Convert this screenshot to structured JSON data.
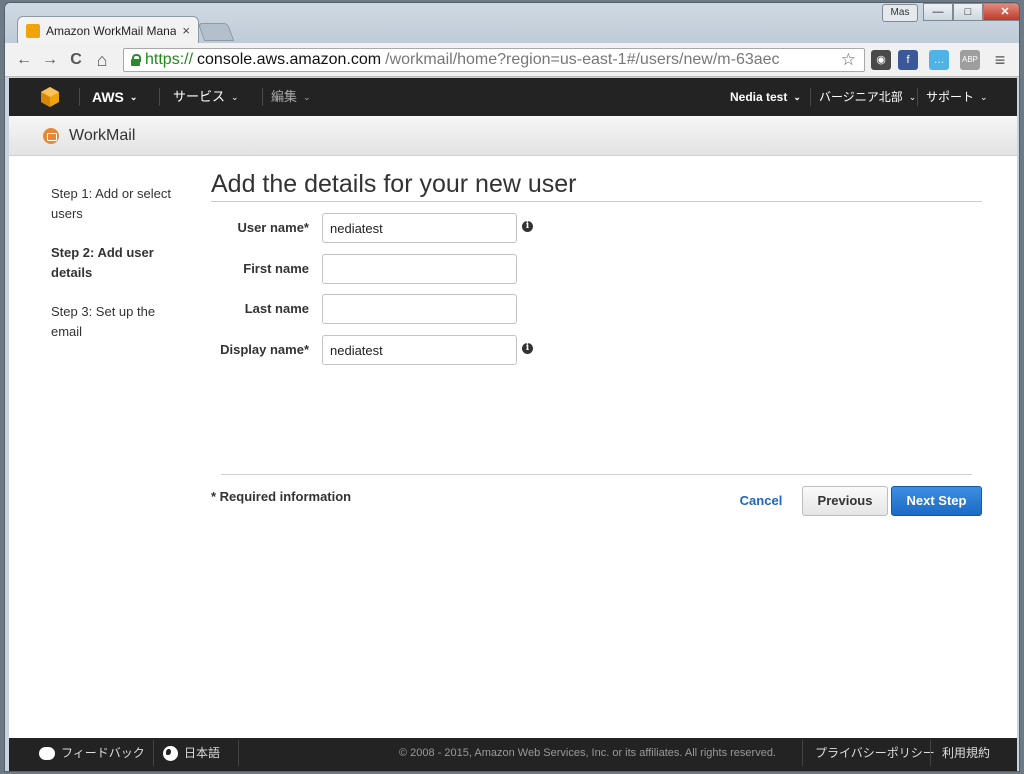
{
  "browser": {
    "tab_title": "Amazon WorkMail Mana",
    "tab_close": "×",
    "user_badge": "Mas",
    "win_min": "—",
    "win_max": "□",
    "win_close": "✕",
    "url": {
      "scheme": "https://",
      "host": "console.aws.amazon.com",
      "path": "/workmail/home?region=us-east-1#/users/new/m-63aec"
    },
    "nav": {
      "back": "←",
      "forward": "→",
      "reload": "C",
      "home": "⌂"
    },
    "star": "☆",
    "extensions": [
      {
        "name": "globe-extension-icon",
        "label": "◉",
        "color": "#4a4a4a"
      },
      {
        "name": "facebook-extension-icon",
        "label": "f",
        "color": "#3b5998"
      },
      {
        "name": "chat-extension-icon",
        "label": "…",
        "color": "#4fb3e8"
      },
      {
        "name": "abp-extension-icon",
        "label": "ABP",
        "color": "#9e9e9e"
      }
    ],
    "menu": "≡"
  },
  "aws_nav": {
    "aws_label": "AWS",
    "services_label": "サービス",
    "edit_label": "編集",
    "user_label": "Nedia test",
    "region_label": "バージニア北部",
    "support_label": "サポート",
    "caret": "⌄"
  },
  "service_bar": {
    "title": "WorkMail"
  },
  "steps": [
    {
      "label": "Step 1: Add or select users"
    },
    {
      "label": "Step 2: Add user details"
    },
    {
      "label": "Step 3: Set up the email"
    }
  ],
  "form": {
    "title": "Add the details for your new user",
    "fields": [
      {
        "label": "User name*",
        "value": "nediatest",
        "info": "i"
      },
      {
        "label": "First name",
        "value": ""
      },
      {
        "label": "Last name",
        "value": ""
      },
      {
        "label": "Display name*",
        "value": "nediatest",
        "info": "i"
      }
    ],
    "required_note": "* Required information",
    "cancel_label": "Cancel",
    "previous_label": "Previous",
    "next_label": "Next Step"
  },
  "footer": {
    "feedback_label": "フィードバック",
    "language_label": "日本語",
    "copyright": "© 2008 - 2015, Amazon Web Services, Inc. or its affiliates. All rights reserved.",
    "privacy_label": "プライバシーポリシー",
    "terms_label": "利用規約"
  },
  "colors": {
    "nav_bg": "#232323",
    "primary_button": "#1b6ac4",
    "link": "#2266bb",
    "brand_orange": "#f0a30a"
  }
}
